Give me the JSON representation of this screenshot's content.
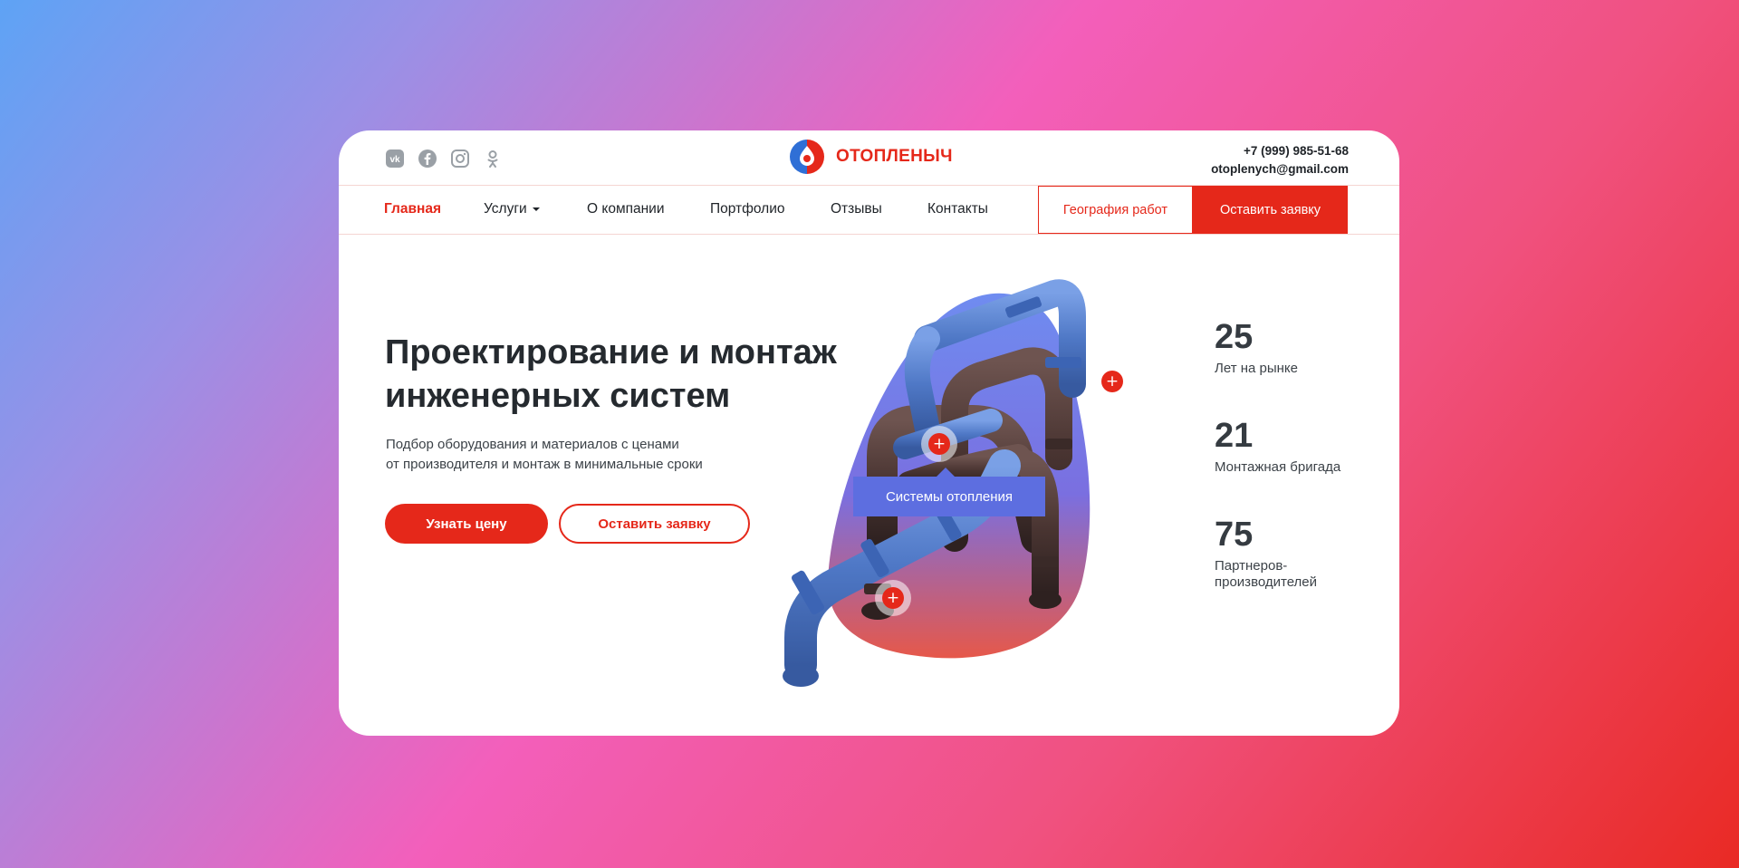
{
  "header": {
    "socials": [
      {
        "icon": "vk-icon"
      },
      {
        "icon": "facebook-icon"
      },
      {
        "icon": "instagram-icon"
      },
      {
        "icon": "odnoklassniki-icon"
      }
    ],
    "logo_text": "ОТОПЛЕНЫЧ",
    "phone": "+7 (999) 985-51-68",
    "email": "otoplenych@gmail.com"
  },
  "nav": {
    "items": [
      {
        "label": "Главная",
        "active": true
      },
      {
        "label": "Услуги",
        "dropdown": true
      },
      {
        "label": "О компании"
      },
      {
        "label": "Портфолио"
      },
      {
        "label": "Отзывы"
      },
      {
        "label": "Контакты"
      }
    ],
    "geo_button": "География работ",
    "order_button": "Оставить заявку"
  },
  "hero": {
    "title_line1": "Проектирование и монтаж",
    "title_line2": "инженерных систем",
    "subtitle_line1": "Подбор оборудования и материалов с ценами",
    "subtitle_line2": "от производителя и монтаж в минимальные сроки",
    "primary_button": "Узнать цену",
    "secondary_button": "Оставить заявку",
    "tooltip": "Системы отопления"
  },
  "stats": [
    {
      "value": "25",
      "label": "Лет на рынке"
    },
    {
      "value": "21",
      "label": "Монтажная бригада"
    },
    {
      "value": "75",
      "label": "Партнеров-производителей"
    }
  ],
  "colors": {
    "accent": "#e5281a",
    "tooltip": "#5d6ee0",
    "pipe_blue": "#5b85cf",
    "pipe_brown": "#4a3532"
  }
}
